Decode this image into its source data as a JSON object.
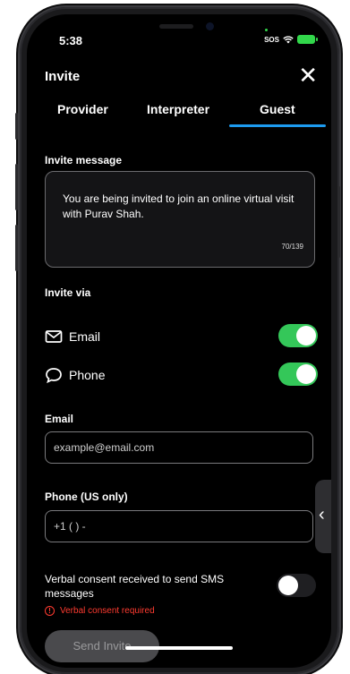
{
  "status_bar": {
    "time": "5:38",
    "sos": "SOS"
  },
  "header": {
    "title": "Invite",
    "close_icon": "close-icon"
  },
  "tabs": [
    {
      "label": "Provider",
      "active": false
    },
    {
      "label": "Interpreter",
      "active": false
    },
    {
      "label": "Guest",
      "active": true
    }
  ],
  "invite_message": {
    "label": "Invite message",
    "text": "You are being invited to join an online virtual visit with Purav Shah.",
    "counter": "70/139"
  },
  "invite_via": {
    "label": "Invite via",
    "options": [
      {
        "label": "Email",
        "icon": "envelope-icon",
        "enabled": true
      },
      {
        "label": "Phone",
        "icon": "chat-bubble-icon",
        "enabled": true
      }
    ]
  },
  "email": {
    "label": "Email",
    "placeholder": "example@email.com"
  },
  "phone": {
    "label": "Phone (US only)",
    "placeholder": "+1 (  )  -"
  },
  "consent": {
    "label": "Verbal consent received to send SMS messages",
    "enabled": false,
    "error": "Verbal consent required"
  },
  "send_button": {
    "label": "Send Invite"
  },
  "colors": {
    "accent": "#1d9bf0",
    "toggle_on": "#34c759",
    "error": "#ff3b30"
  }
}
